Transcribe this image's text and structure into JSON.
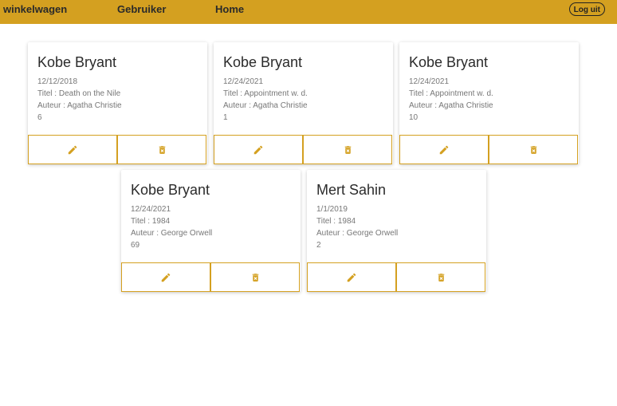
{
  "nav": {
    "items": [
      "winkelwagen",
      "Gebruiker",
      "Home"
    ],
    "logout_label": "Log uit"
  },
  "colors": {
    "accent": "#d4a020",
    "text_dark": "#2b2b2b",
    "text_muted": "#777777"
  },
  "cards": [
    {
      "name": "Kobe Bryant",
      "date": "12/12/2018",
      "titel": "Titel : Death on the Nile",
      "auteur": "Auteur : Agatha Christie",
      "count": "6"
    },
    {
      "name": "Kobe Bryant",
      "date": "12/24/2021",
      "titel": "Titel : Appointment w. d.",
      "auteur": "Auteur : Agatha Christie",
      "count": "1"
    },
    {
      "name": "Kobe Bryant",
      "date": "12/24/2021",
      "titel": "Titel : Appointment w. d.",
      "auteur": "Auteur : Agatha Christie",
      "count": "10"
    },
    {
      "name": "Kobe Bryant",
      "date": "12/24/2021",
      "titel": "Titel : 1984",
      "auteur": "Auteur : George Orwell",
      "count": "69"
    },
    {
      "name": "Mert Sahin",
      "date": "1/1/2019",
      "titel": "Titel : 1984",
      "auteur": "Auteur : George Orwell",
      "count": "2"
    }
  ],
  "icons": {
    "edit": "pencil-icon",
    "delete": "trash-icon"
  }
}
